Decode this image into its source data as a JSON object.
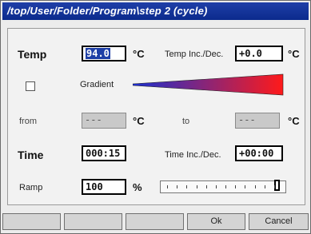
{
  "window": {
    "title": "/top/User/Folder/Program\\step 2 (cycle)"
  },
  "temp": {
    "label": "Temp",
    "value": "94.0",
    "unit": "°C"
  },
  "temp_inc": {
    "label": "Temp Inc./Dec.",
    "value": "+0.0",
    "unit": "°C"
  },
  "gradient": {
    "label": "Gradient",
    "checked": false,
    "colors": [
      "#1a2fd0",
      "#ff1a1a"
    ]
  },
  "from": {
    "label": "from",
    "value": "---",
    "unit": "°C"
  },
  "to": {
    "label": "to",
    "value": "---",
    "unit": "°C"
  },
  "time": {
    "label": "Time",
    "value": "000:15"
  },
  "time_inc": {
    "label": "Time Inc./Dec.",
    "value": "+00:00"
  },
  "ramp": {
    "label": "Ramp",
    "value": "100",
    "unit": "%",
    "slider_fraction": 1.0
  },
  "buttons": [
    "",
    "",
    "",
    "Ok",
    "Cancel"
  ]
}
